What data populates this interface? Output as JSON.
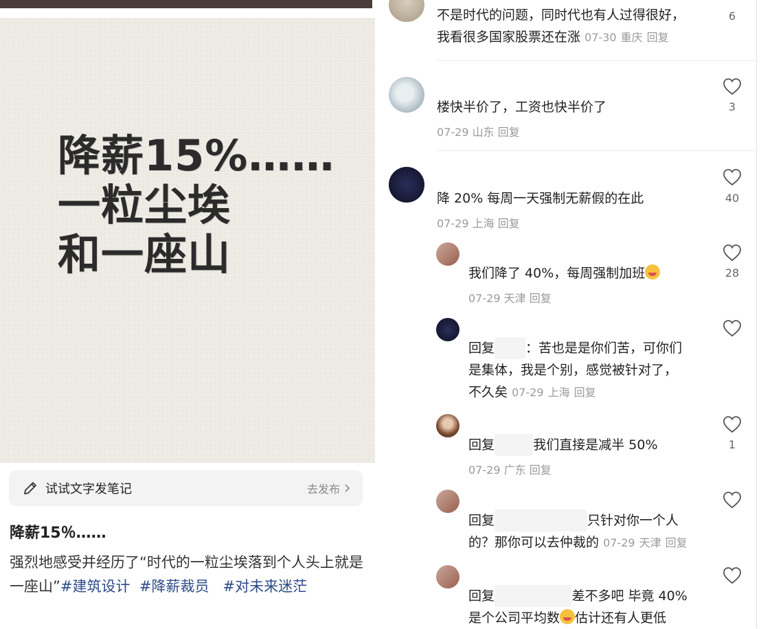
{
  "post": {
    "poster_lines": [
      "降薪15%……",
      "一粒尘埃",
      "和一座山"
    ],
    "try_text_label": "试试文字发笔记",
    "try_go_label": "去发布",
    "title": "降薪15％……",
    "body_prefix": "强烈地感受并经历了“时代的一粒尘埃落到个人头上就是一座山”",
    "tags": [
      "#建筑设计",
      "#降薪裁员",
      "#对未来迷茫"
    ]
  },
  "comments": [
    {
      "text_line1": "不是时代的问题，同时代也有人过得很好，",
      "text_line2": "我看很多国家股票还在涨",
      "date": "07-30",
      "location": "重庆",
      "reply": "回复",
      "likes": "6"
    },
    {
      "text": "楼快半价了，工资也快半价了",
      "date": "07-29",
      "location": "山东",
      "reply": "回复",
      "likes": "3"
    },
    {
      "text": "降 20% 每周一天强制无薪假的在此",
      "date": "07-29",
      "location": "上海",
      "reply": "回复",
      "likes": "40"
    }
  ],
  "replies": [
    {
      "text": "我们降了 40%，每周强制加班",
      "date": "07-29",
      "location": "天津",
      "reply": "回复",
      "likes": "28"
    },
    {
      "prefix": "回复",
      "line1_rest": "：苦也是是你们苦，可你们",
      "line2": "是集体，我是个别，感觉被针对了，",
      "line3": "不久矣",
      "date": "07-29",
      "location": "上海",
      "reply": "回复",
      "likes": ""
    },
    {
      "prefix": "回复",
      "text_rest": "我们直接是减半 50%",
      "date": "07-29",
      "location": "广东",
      "reply": "回复",
      "likes": "1"
    },
    {
      "prefix": "回复",
      "line1_rest": "只针对你一个人",
      "line2": "的？那你可以去仲裁的",
      "date": "07-29",
      "location": "天津",
      "reply": "回复",
      "likes": ""
    },
    {
      "prefix": "回复",
      "line1_rest": "差不多吧 毕竟 40%",
      "line2_a": "是个公司平均数",
      "line2_b": "估计还有人更低",
      "likes": ""
    }
  ],
  "icons": {
    "heart": "heart-icon",
    "pencil": "pencil-icon",
    "chevron": "chevron-right-icon"
  },
  "colors": {
    "tag": "#2b4a8a",
    "meta": "#9a9a9a",
    "poster_bg": "#efece6"
  }
}
